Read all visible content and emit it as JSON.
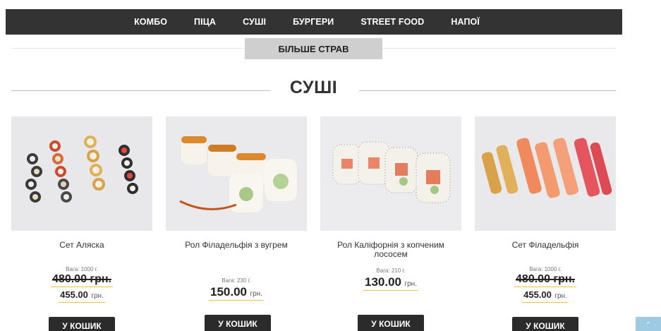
{
  "nav": {
    "items": [
      "КОМБО",
      "ПІЦА",
      "СУШІ",
      "БУРГЕРИ",
      "STREET FOOD",
      "НАПОЇ"
    ]
  },
  "more_button": "БІЛЬШЕ СТРАВ",
  "section_title": "СУШІ",
  "products": [
    {
      "title": "Сет Аляска",
      "weight": "Вага: 1000 г.",
      "old_price": "480.00 грн.",
      "price": "455.00",
      "currency": "грн.",
      "button": "У КОШИК"
    },
    {
      "title": "Рол Філадельфія з вугрем",
      "weight": "Вага: 230 г.",
      "price": "150.00",
      "currency": "грн.",
      "button": "У КОШИК"
    },
    {
      "title": "Рол Каліфорнія з копченим лососем",
      "weight": "Вага: 210 г.",
      "price": "130.00",
      "currency": "грн.",
      "button": "У КОШИК"
    },
    {
      "title": "Сет Філадельфія",
      "weight": "Вага: 1000 г.",
      "old_price": "480.00 грн.",
      "price": "455.00",
      "currency": "грн.",
      "button": "У КОШИК"
    }
  ],
  "scroll_top_icon": "chevron-up-icon",
  "colors": {
    "navbar": "#333333",
    "accent_underline": "#f0c040",
    "button": "#2b2b2b",
    "scroll_top": "#9ecae3"
  }
}
